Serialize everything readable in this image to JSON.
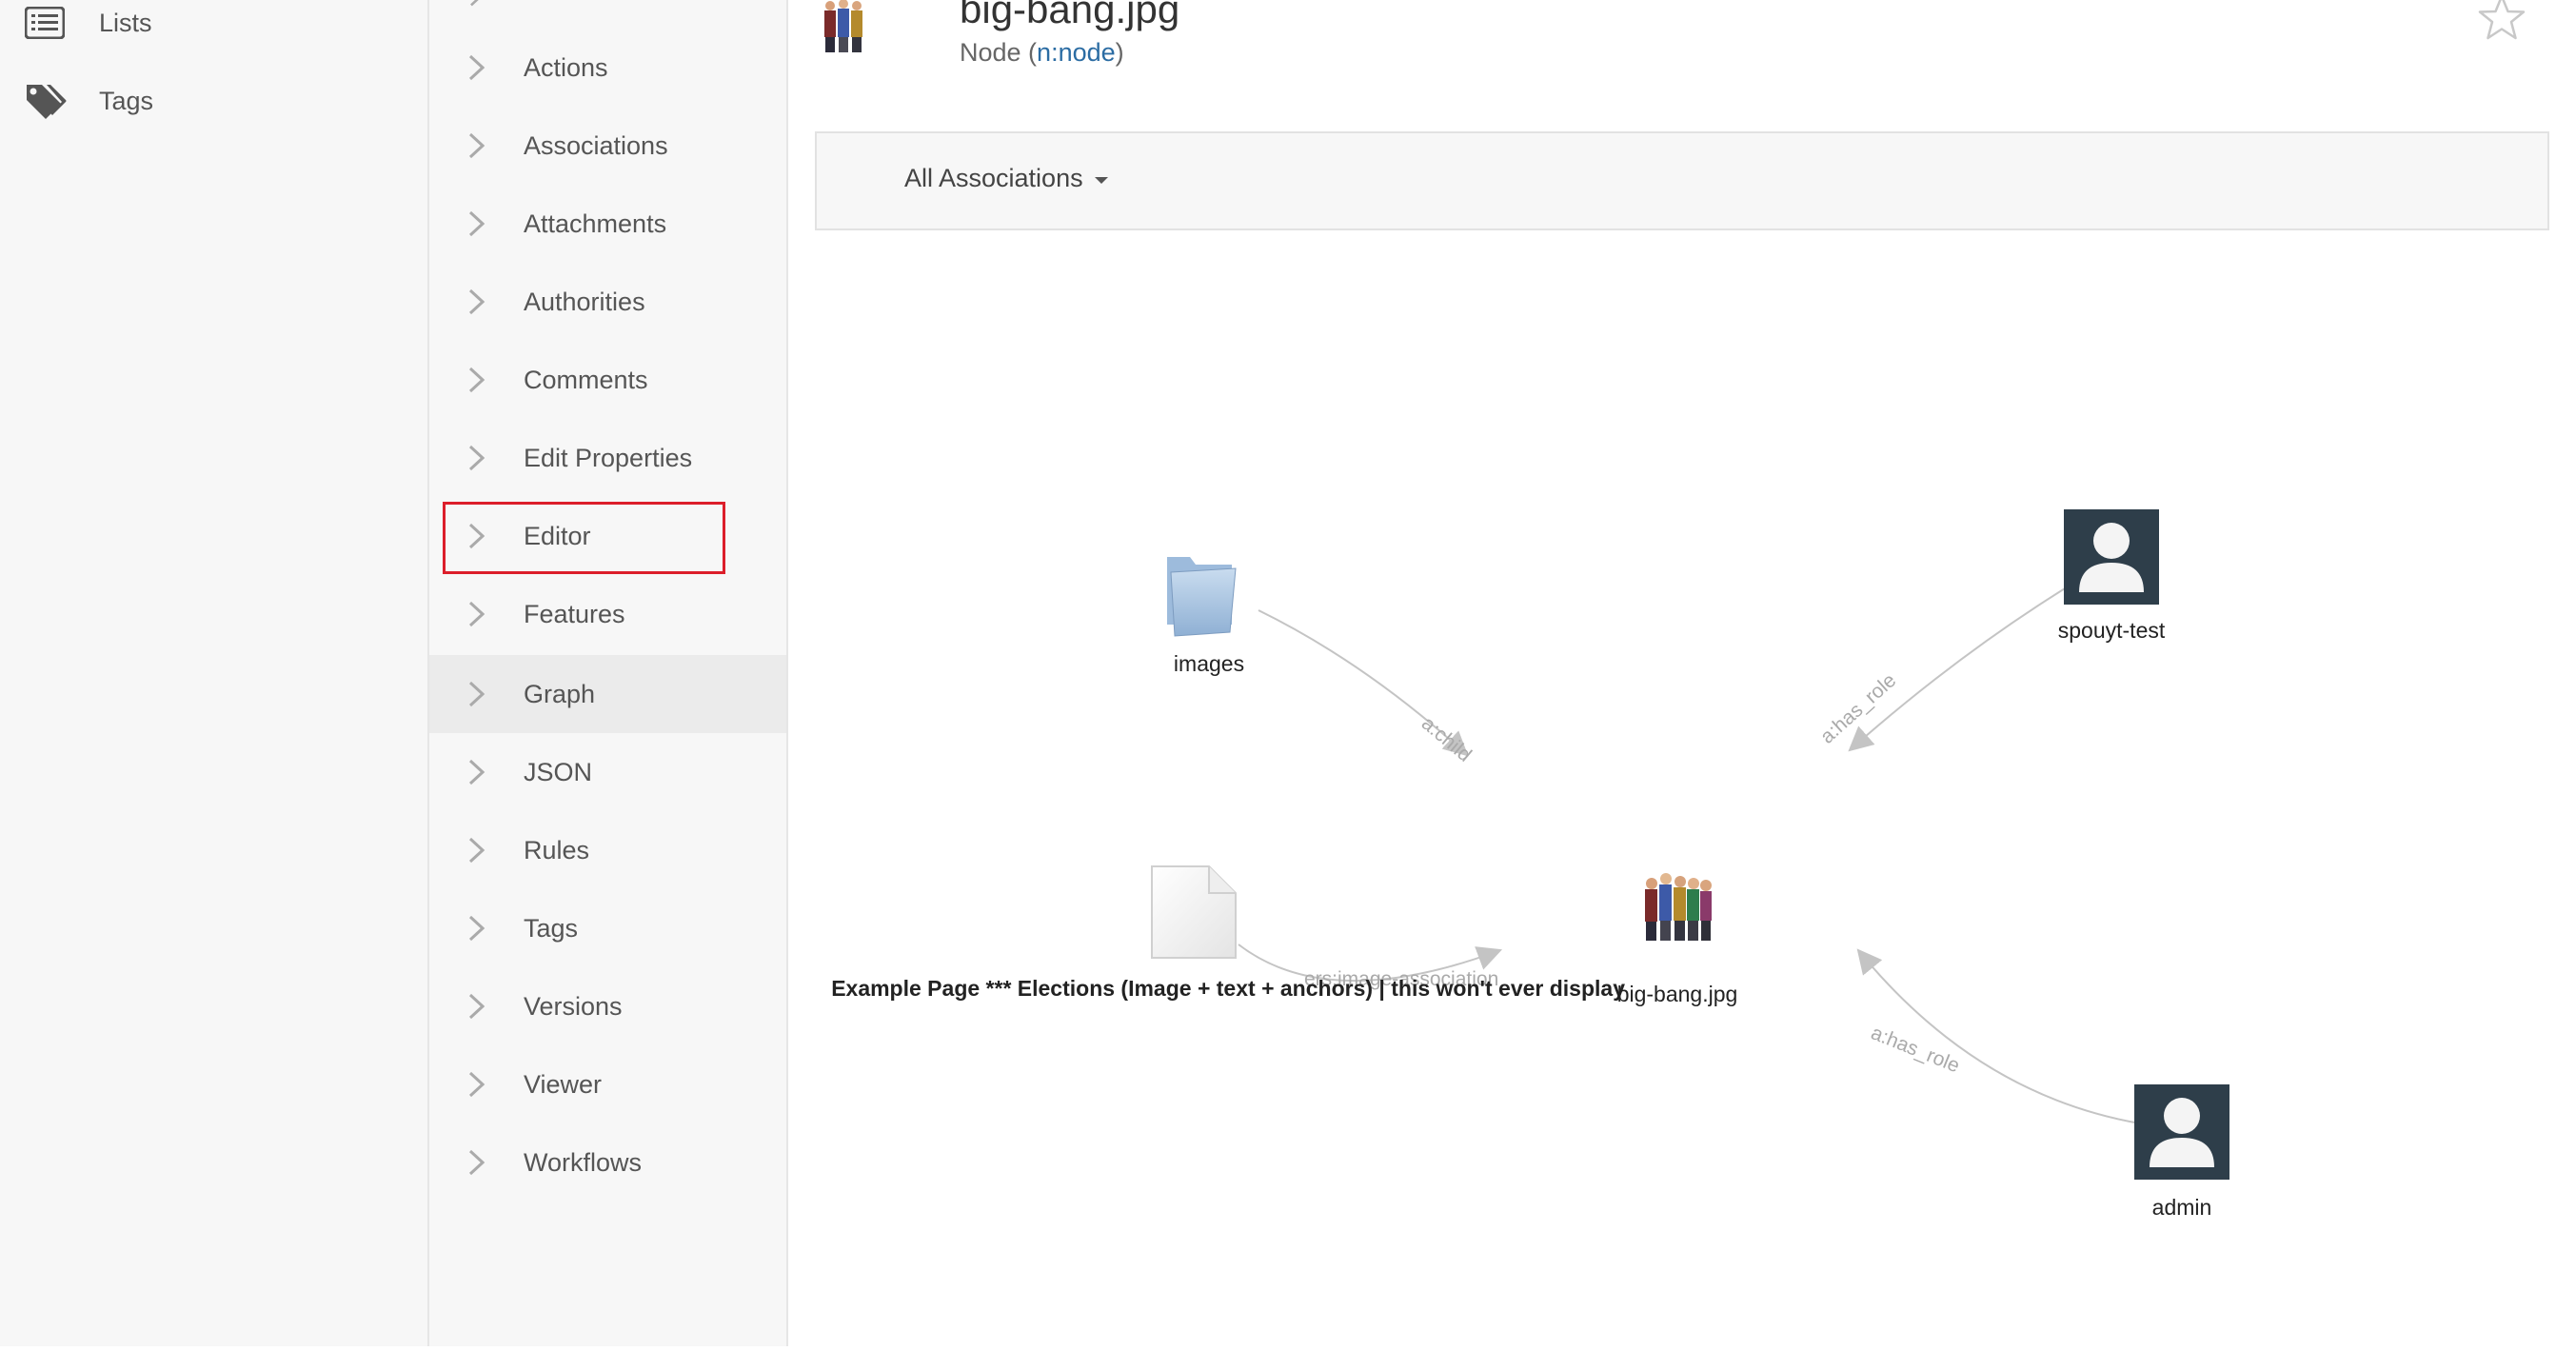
{
  "left_nav": {
    "items": [
      {
        "label": "Lists",
        "icon": "list-icon"
      },
      {
        "label": "Tags",
        "icon": "tags-icon"
      }
    ]
  },
  "menu": {
    "items": [
      {
        "label": "Actions"
      },
      {
        "label": "Associations"
      },
      {
        "label": "Attachments"
      },
      {
        "label": "Authorities"
      },
      {
        "label": "Comments"
      },
      {
        "label": "Edit Properties"
      },
      {
        "label": "Editor",
        "highlighted": true
      },
      {
        "label": "Features"
      },
      {
        "label": "Graph",
        "active": true
      },
      {
        "label": "JSON"
      },
      {
        "label": "Rules"
      },
      {
        "label": "Tags"
      },
      {
        "label": "Versions"
      },
      {
        "label": "Viewer"
      },
      {
        "label": "Workflows"
      }
    ]
  },
  "header": {
    "title": "big-bang.jpg",
    "subtitle_prefix": "Node (",
    "type_link": "n:node",
    "subtitle_suffix": ")"
  },
  "filter": {
    "label": "All Associations"
  },
  "graph": {
    "nodes": [
      {
        "label": "images",
        "icon": "folder-icon"
      },
      {
        "label": "spouyt-test",
        "icon": "user-avatar-icon"
      },
      {
        "label": "big-bang.jpg",
        "icon": "photo-thumbnail-icon"
      },
      {
        "label": "admin",
        "icon": "user-avatar-icon"
      },
      {
        "label": "Example Page *** Elections (Image + text + anchors) | this won't ever display",
        "icon": "document-icon"
      }
    ],
    "edges": [
      {
        "label": "a:child"
      },
      {
        "label": "a:has_role"
      },
      {
        "label": "a:has_role"
      },
      {
        "label": "ers:image-association"
      }
    ]
  },
  "colors": {
    "highlight_outline": "#dc1e2a",
    "link": "#2b6ca3",
    "edge": "#c4c4c4",
    "active_menu_bg": "#ebebeb"
  }
}
